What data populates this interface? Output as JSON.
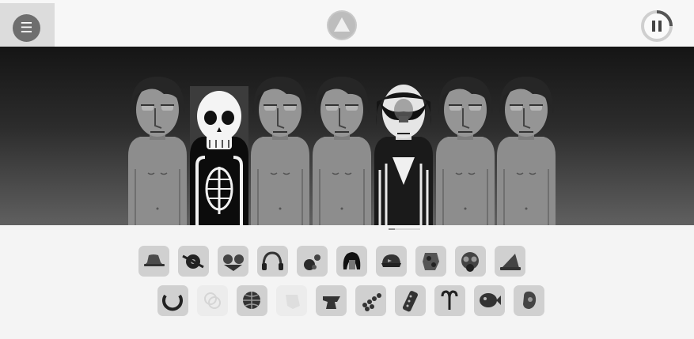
{
  "app": {
    "menu_icon": "hamburger-icon",
    "logo_icon": "triangle-logo-icon",
    "pause_icon": "pause-icon"
  },
  "stage": {
    "characters": [
      {
        "slot": 1,
        "state": "plain"
      },
      {
        "slot": 2,
        "state": "skeleton"
      },
      {
        "slot": 3,
        "state": "plain"
      },
      {
        "slot": 4,
        "state": "plain"
      },
      {
        "slot": 5,
        "state": "masked"
      },
      {
        "slot": 6,
        "state": "plain"
      },
      {
        "slot": 7,
        "state": "plain"
      }
    ]
  },
  "palette": {
    "row1": [
      {
        "icon": "hat-icon",
        "used": false
      },
      {
        "icon": "disc-icon",
        "used": false
      },
      {
        "icon": "glasses-icon",
        "used": false
      },
      {
        "icon": "headphones-icon",
        "used": false
      },
      {
        "icon": "drops-icon",
        "used": false
      },
      {
        "icon": "hair-icon",
        "used": false
      },
      {
        "icon": "cap-icon",
        "used": false
      },
      {
        "icon": "pattern-icon",
        "used": false
      },
      {
        "icon": "gas-mask-icon",
        "used": false
      },
      {
        "icon": "witch-hat-icon",
        "used": false
      }
    ],
    "row2": [
      {
        "icon": "ring-icon",
        "used": false
      },
      {
        "icon": "coil-icon",
        "used": true
      },
      {
        "icon": "globe-icon",
        "used": false
      },
      {
        "icon": "skull-icon",
        "used": true
      },
      {
        "icon": "anvil-icon",
        "used": false
      },
      {
        "icon": "dots-icon",
        "used": false
      },
      {
        "icon": "remote-icon",
        "used": false
      },
      {
        "icon": "aries-icon",
        "used": false
      },
      {
        "icon": "fish-icon",
        "used": false
      },
      {
        "icon": "ear-icon",
        "used": false
      }
    ]
  }
}
